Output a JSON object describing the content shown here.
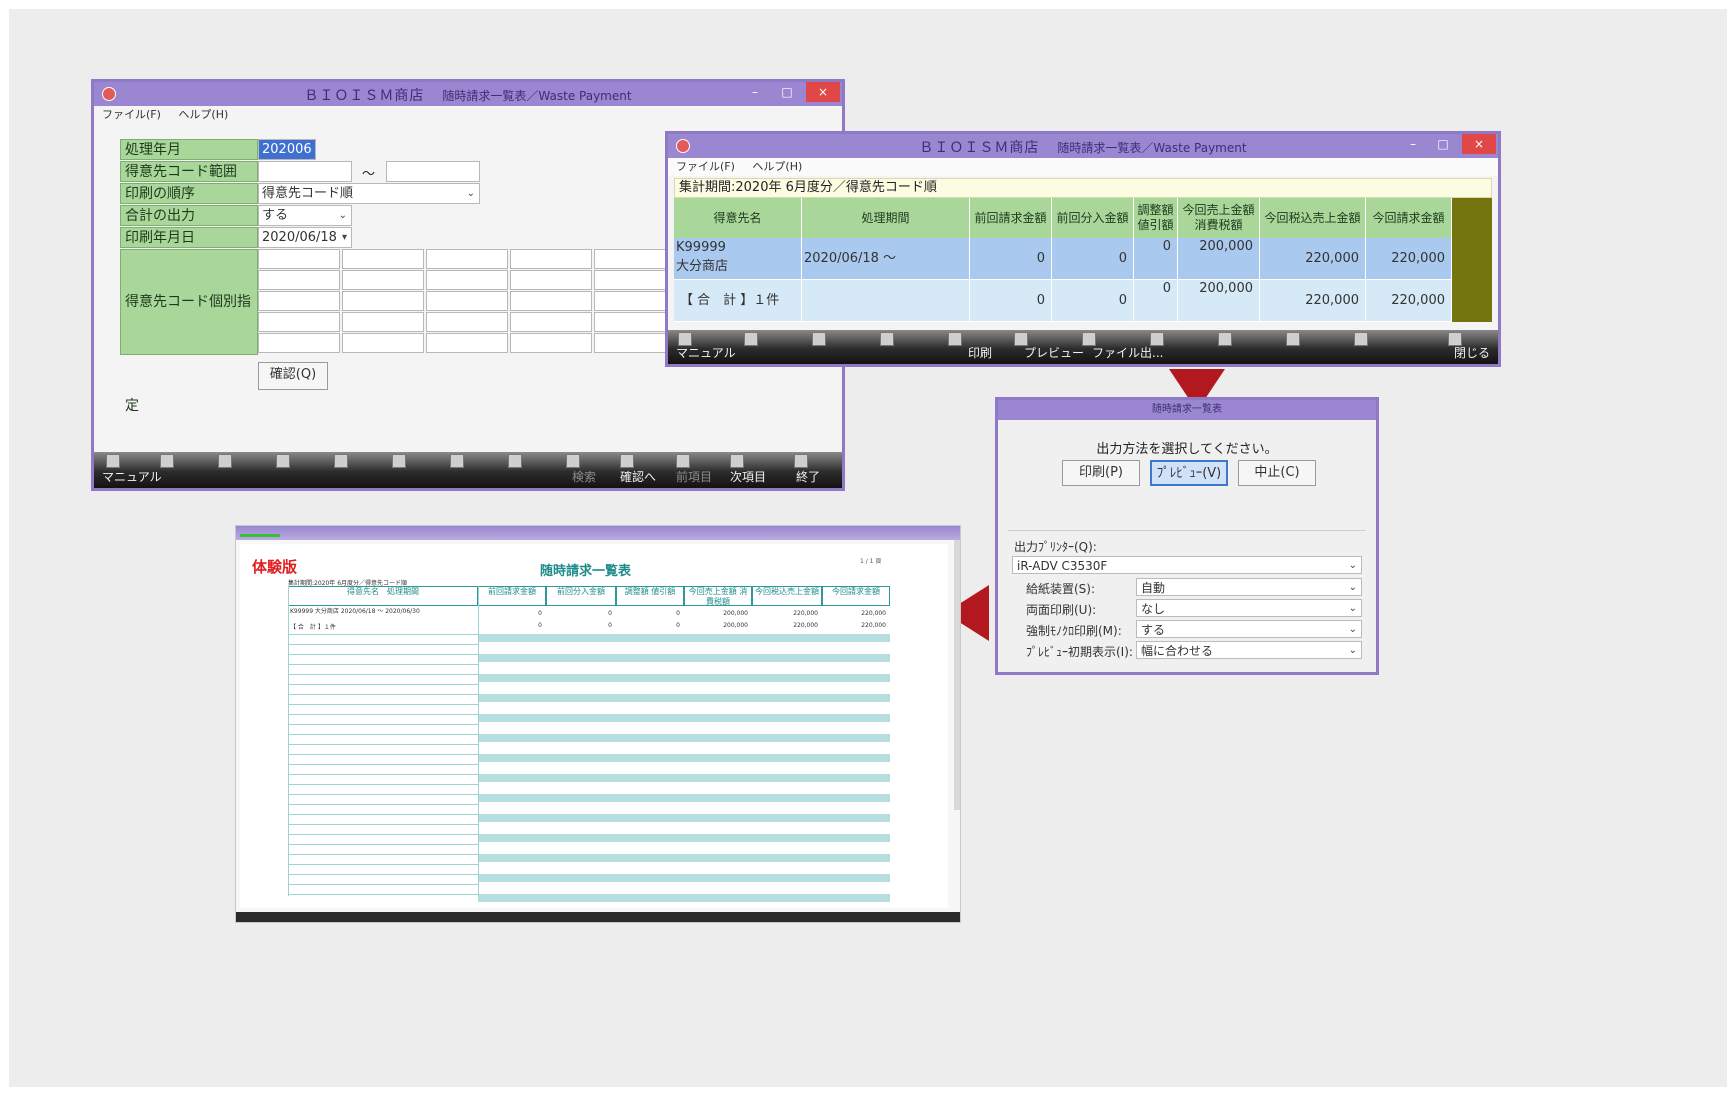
{
  "app": {
    "shop": "ＢＩＯＩＳＭ商店",
    "title_tail": "随時請求一覧表／Waste Payment",
    "menu": [
      "ファイル(F)",
      "ヘルプ(H)"
    ],
    "minimize": "–",
    "maximize": "□",
    "close": "×"
  },
  "setup": {
    "fields": [
      {
        "label": "処理年月",
        "value": "202006"
      },
      {
        "label": "得意先コード範囲",
        "value": "",
        "value_to": "",
        "sep": "～"
      },
      {
        "label": "印刷の順序",
        "value": "得意先コード順"
      },
      {
        "label": "合計の出力",
        "value": "する"
      },
      {
        "label": "印刷年月日",
        "value": "2020/06/18"
      },
      {
        "label": "得意先コード個別指定",
        "value": ""
      }
    ],
    "confirm_button": "確認(Q)",
    "toolbar": [
      {
        "label": "マニュアル",
        "enabled": true
      },
      {
        "label": "検索",
        "enabled": false
      },
      {
        "label": "確認へ",
        "enabled": true
      },
      {
        "label": "前項目",
        "enabled": false
      },
      {
        "label": "次項目",
        "enabled": true
      },
      {
        "label": "終了",
        "enabled": true
      }
    ]
  },
  "list": {
    "period": "集計期間:2020年 6月度分／得意先コード順",
    "columns": [
      "得意先名",
      "処理期間",
      "前回請求金額",
      "前回分入金額",
      "調整額",
      "値引額",
      "今回売上金額",
      "消費税額",
      "今回税込売上金額",
      "今回請求金額"
    ],
    "rows": [
      {
        "code": "K99999",
        "name": "大分商店",
        "period": "2020/06/18 ～ 2020/06/30",
        "prev": "0",
        "paid": "0",
        "adjust": "0",
        "sales": "200,000",
        "tax": "",
        "taxed": "220,000",
        "billed": "220,000"
      },
      {
        "code": "",
        "name": "【 合　計 】１件",
        "period": "",
        "prev": "0",
        "paid": "0",
        "adjust": "0",
        "sales": "200,000",
        "tax": "",
        "taxed": "220,000",
        "billed": "220,000"
      }
    ],
    "toolbar": [
      {
        "label": "マニュアル"
      },
      {
        "label": "印刷"
      },
      {
        "label": "プレビュー"
      },
      {
        "label": "ファイル出..."
      },
      {
        "label": "閉じる"
      }
    ]
  },
  "dialog": {
    "title": "随時請求一覧表",
    "message": "出力方法を選択してください。",
    "buttons": [
      "印刷(P)",
      "ﾌﾟﾚﾋﾞｭｰ(V)",
      "中止(C)"
    ],
    "printer_label": "出力ﾌﾟﾘﾝﾀｰ(Q):",
    "printer_value": "iR-ADV C3530F",
    "options": [
      {
        "label": "給紙装置(S):",
        "value": "自動"
      },
      {
        "label": "両面印刷(U):",
        "value": "なし"
      },
      {
        "label": "強制ﾓﾉｸﾛ印刷(M):",
        "value": "する"
      },
      {
        "label": "ﾌﾟﾚﾋﾞｭｰ初期表示(I):",
        "value": "幅に合わせる"
      }
    ]
  },
  "preview": {
    "trial": "体験版",
    "title": "随時請求一覧表",
    "page": "1 / 1 頁",
    "colors": {
      "trial": "#e02020",
      "title": "#1f8a8a",
      "band": "#b7dede"
    }
  }
}
